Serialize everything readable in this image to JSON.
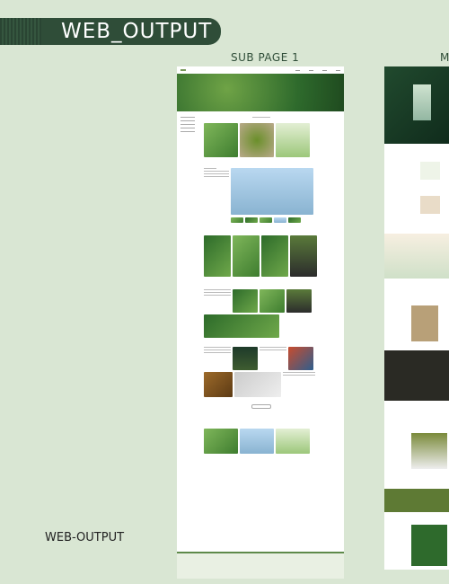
{
  "header": {
    "title": "WEB_OUTPUT"
  },
  "labels": {
    "page1": "SUB PAGE 1",
    "page2": "M"
  },
  "footer_label": "WEB-OUTPUT"
}
